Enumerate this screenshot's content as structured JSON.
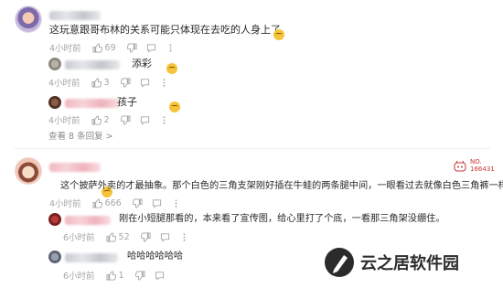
{
  "comments": [
    {
      "text": "这玩意跟哥布林的关系可能只体现在去吃的人身上了",
      "time": "4小时前",
      "likes": "69",
      "replies": [
        {
          "text": "添彩",
          "time": "4小时前",
          "likes": "3"
        },
        {
          "text": "孩子",
          "time": "4小时前",
          "likes": "2"
        }
      ],
      "more_replies": "查看 8 条回复 >"
    },
    {
      "text": "这个披萨外卖的才最抽象。那个白色的三角支架刚好插在牛蛙的两条腿中间，一眼看过去就像白色三角裤一样",
      "time": "4小时前",
      "likes": "666",
      "badge_line1": "NO.",
      "badge_line2": "166431",
      "replies": [
        {
          "text": "刚在小短腿那看的，本来看了宣传图，给心里打了个底，一看那三角架没绷住。",
          "time": "6小时前",
          "likes": "52"
        },
        {
          "text": "哈哈哈哈哈哈",
          "time": "6小时前",
          "likes": "1"
        }
      ]
    }
  ],
  "watermark": "云之居软件园"
}
